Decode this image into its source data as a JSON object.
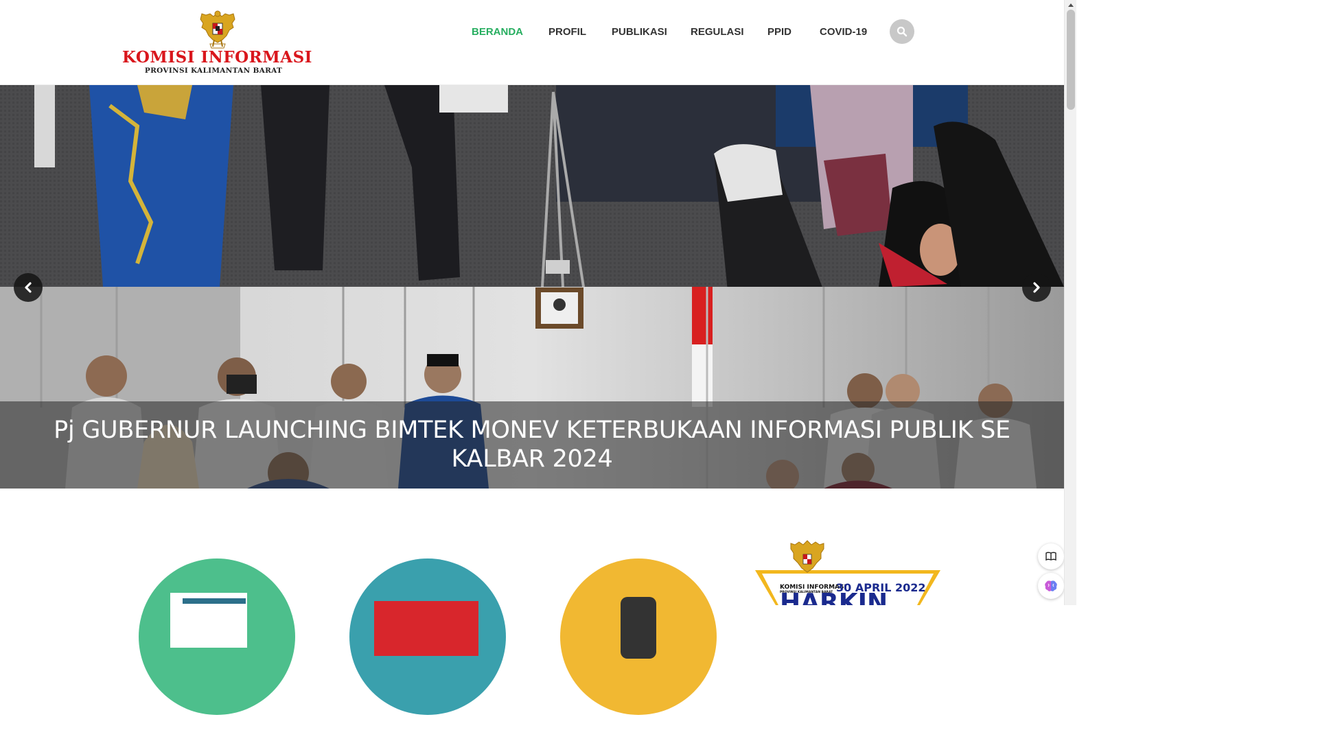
{
  "logo": {
    "title": "KOMISI INFORMASI",
    "subtitle": "PROVINSI KALIMANTAN BARAT"
  },
  "nav": {
    "items": [
      {
        "label": "BERANDA",
        "active": true
      },
      {
        "label": "PROFIL",
        "active": false
      },
      {
        "label": "PUBLIKASI",
        "active": false
      },
      {
        "label": "REGULASI",
        "active": false
      },
      {
        "label": "PPID",
        "active": false
      },
      {
        "label": "COVID-19",
        "active": false
      }
    ],
    "active_color": "#27ae60",
    "search_icon": "search-icon"
  },
  "slider": {
    "caption": "Pj GUBERNUR LAUNCHING BIMTEK MONEV KETERBUKAAN INFORMASI PUBLIK SE KALBAR 2024",
    "prev_icon": "chevron-left-icon",
    "next_icon": "chevron-right-icon"
  },
  "services": {
    "colors": [
      "#4dbf8c",
      "#3aa0ad",
      "#f1b832"
    ]
  },
  "harkin": {
    "org_line1": "KOMISI INFORMASI",
    "org_line2": "PROVINSI KALIMANTAN BARAT",
    "date": "30 APRIL 2022",
    "title": "HARKIN"
  },
  "floating": {
    "icons": [
      "book-icon",
      "brain-icon"
    ]
  }
}
